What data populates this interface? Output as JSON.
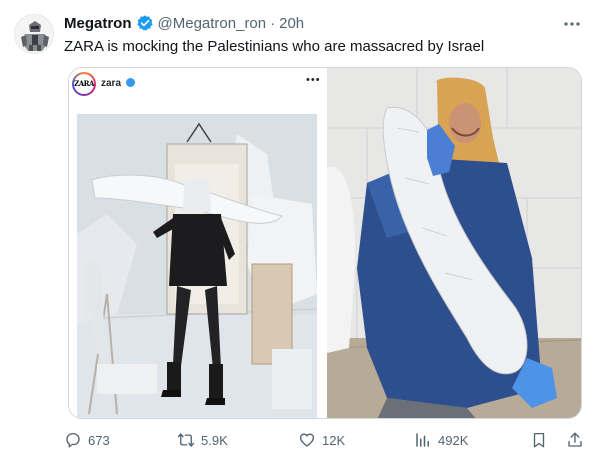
{
  "author": {
    "name": "Megatron",
    "handle": "@Megatron_ron",
    "separator": "·",
    "time": "20h",
    "verified": true,
    "avatar_icon": "robot-avatar-icon"
  },
  "tweet": {
    "text": "ZARA is mocking the Palestinians who are massacred by Israel"
  },
  "embedded_post": {
    "account": "zara",
    "logo_text": "ZARA",
    "verified": true
  },
  "metrics": {
    "replies": "673",
    "retweets": "5.9K",
    "likes": "12K",
    "views": "492K"
  },
  "colors": {
    "verified_badge": "#1d9bf0",
    "text_primary": "#0f1419",
    "text_secondary": "#536471",
    "border": "#cfd9de",
    "instagram_verified": "#3897f0"
  },
  "icons": {
    "more": "more-options-icon",
    "reply": "reply-icon",
    "retweet": "retweet-icon",
    "like": "heart-icon",
    "views": "views-chart-icon",
    "bookmark": "bookmark-icon",
    "share": "share-icon"
  }
}
